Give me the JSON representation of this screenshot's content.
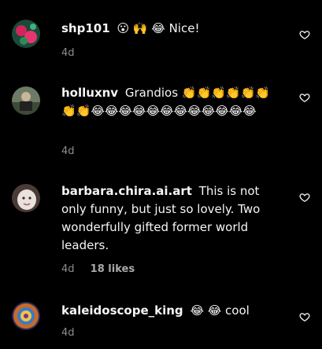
{
  "comments": [
    {
      "username": "shp101",
      "text": "😮 🙌 😂 Nice!",
      "time": "4d",
      "likes": "",
      "avatar_icon": "avatar-roses-icon"
    },
    {
      "username": "holluxnv",
      "text": "Grandios 👏👏👏👏👏👏👏👏😂😂😂😂😂😂😂😂😂😂😂😂",
      "time": "4d",
      "likes": "",
      "avatar_icon": "avatar-photo-icon"
    },
    {
      "username": "barbara.chira.ai.art",
      "text": "This is not only funny, but just so lovely. Two wonderfully gifted former world leaders.",
      "time": "4d",
      "likes": "18 likes",
      "avatar_icon": "avatar-face-icon"
    },
    {
      "username": "kaleidoscope_king",
      "text": "😂 😂 cool",
      "time": "4d",
      "likes": "",
      "avatar_icon": "avatar-kaleidoscope-icon"
    }
  ],
  "colors": {
    "background": "#000000",
    "text": "#f5f5f5",
    "meta": "#8e8e8e"
  }
}
